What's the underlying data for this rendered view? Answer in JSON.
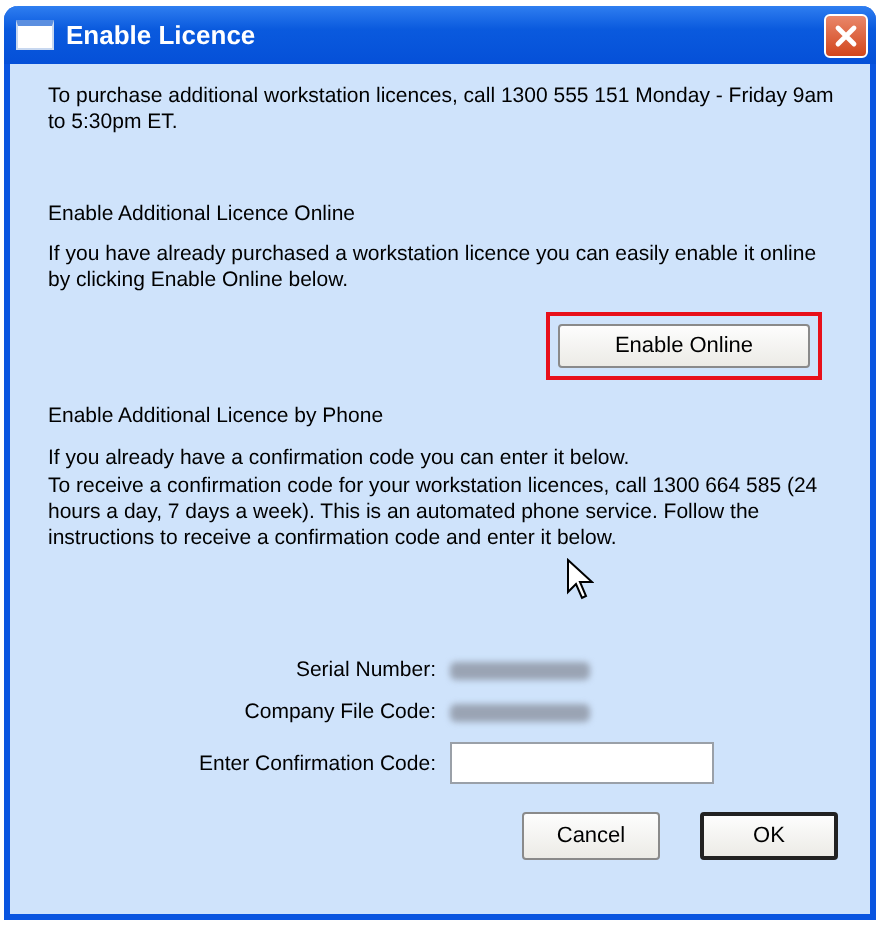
{
  "window": {
    "title": "Enable Licence"
  },
  "intro": "To purchase additional workstation licences, call 1300 555 151 Monday - Friday 9am to 5:30pm ET.",
  "online": {
    "heading": "Enable Additional Licence Online",
    "text": "If you have already purchased a workstation licence you can easily enable it online by clicking Enable Online below.",
    "button": "Enable Online",
    "highlighted": true
  },
  "phone": {
    "heading": "Enable Additional Licence by Phone",
    "lines": [
      "If you already have a confirmation code you can enter it below.",
      "To receive a confirmation code for your workstation licences, call 1300 664 585 (24 hours a day, 7 days a week).  This is an automated phone service.  Follow the instructions to receive a confirmation code and enter it below."
    ]
  },
  "fields": [
    {
      "kind": "blurred",
      "label": "Serial Number:"
    },
    {
      "kind": "blurred",
      "label": "Company File Code:"
    },
    {
      "kind": "input",
      "label": "Enter Confirmation Code:"
    }
  ],
  "buttons": [
    {
      "label": "Cancel",
      "default": false
    },
    {
      "label": "OK",
      "default": true
    }
  ]
}
